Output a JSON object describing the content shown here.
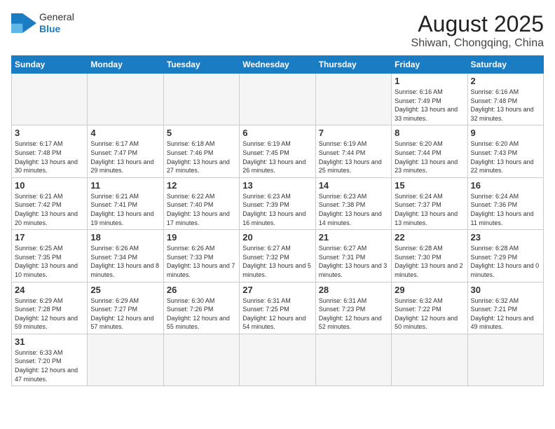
{
  "logo": {
    "general": "General",
    "blue": "Blue"
  },
  "title": "August 2025",
  "subtitle": "Shiwan, Chongqing, China",
  "weekdays": [
    "Sunday",
    "Monday",
    "Tuesday",
    "Wednesday",
    "Thursday",
    "Friday",
    "Saturday"
  ],
  "weeks": [
    [
      {
        "day": "",
        "empty": true
      },
      {
        "day": "",
        "empty": true
      },
      {
        "day": "",
        "empty": true
      },
      {
        "day": "",
        "empty": true
      },
      {
        "day": "",
        "empty": true
      },
      {
        "day": "1",
        "sunrise": "6:16 AM",
        "sunset": "7:49 PM",
        "daylight": "13 hours and 33 minutes."
      },
      {
        "day": "2",
        "sunrise": "6:16 AM",
        "sunset": "7:48 PM",
        "daylight": "13 hours and 32 minutes."
      }
    ],
    [
      {
        "day": "3",
        "sunrise": "6:17 AM",
        "sunset": "7:48 PM",
        "daylight": "13 hours and 30 minutes."
      },
      {
        "day": "4",
        "sunrise": "6:17 AM",
        "sunset": "7:47 PM",
        "daylight": "13 hours and 29 minutes."
      },
      {
        "day": "5",
        "sunrise": "6:18 AM",
        "sunset": "7:46 PM",
        "daylight": "13 hours and 27 minutes."
      },
      {
        "day": "6",
        "sunrise": "6:19 AM",
        "sunset": "7:45 PM",
        "daylight": "13 hours and 26 minutes."
      },
      {
        "day": "7",
        "sunrise": "6:19 AM",
        "sunset": "7:44 PM",
        "daylight": "13 hours and 25 minutes."
      },
      {
        "day": "8",
        "sunrise": "6:20 AM",
        "sunset": "7:44 PM",
        "daylight": "13 hours and 23 minutes."
      },
      {
        "day": "9",
        "sunrise": "6:20 AM",
        "sunset": "7:43 PM",
        "daylight": "13 hours and 22 minutes."
      }
    ],
    [
      {
        "day": "10",
        "sunrise": "6:21 AM",
        "sunset": "7:42 PM",
        "daylight": "13 hours and 20 minutes."
      },
      {
        "day": "11",
        "sunrise": "6:21 AM",
        "sunset": "7:41 PM",
        "daylight": "13 hours and 19 minutes."
      },
      {
        "day": "12",
        "sunrise": "6:22 AM",
        "sunset": "7:40 PM",
        "daylight": "13 hours and 17 minutes."
      },
      {
        "day": "13",
        "sunrise": "6:23 AM",
        "sunset": "7:39 PM",
        "daylight": "13 hours and 16 minutes."
      },
      {
        "day": "14",
        "sunrise": "6:23 AM",
        "sunset": "7:38 PM",
        "daylight": "13 hours and 14 minutes."
      },
      {
        "day": "15",
        "sunrise": "6:24 AM",
        "sunset": "7:37 PM",
        "daylight": "13 hours and 13 minutes."
      },
      {
        "day": "16",
        "sunrise": "6:24 AM",
        "sunset": "7:36 PM",
        "daylight": "13 hours and 11 minutes."
      }
    ],
    [
      {
        "day": "17",
        "sunrise": "6:25 AM",
        "sunset": "7:35 PM",
        "daylight": "13 hours and 10 minutes."
      },
      {
        "day": "18",
        "sunrise": "6:26 AM",
        "sunset": "7:34 PM",
        "daylight": "13 hours and 8 minutes."
      },
      {
        "day": "19",
        "sunrise": "6:26 AM",
        "sunset": "7:33 PM",
        "daylight": "13 hours and 7 minutes."
      },
      {
        "day": "20",
        "sunrise": "6:27 AM",
        "sunset": "7:32 PM",
        "daylight": "13 hours and 5 minutes."
      },
      {
        "day": "21",
        "sunrise": "6:27 AM",
        "sunset": "7:31 PM",
        "daylight": "13 hours and 3 minutes."
      },
      {
        "day": "22",
        "sunrise": "6:28 AM",
        "sunset": "7:30 PM",
        "daylight": "13 hours and 2 minutes."
      },
      {
        "day": "23",
        "sunrise": "6:28 AM",
        "sunset": "7:29 PM",
        "daylight": "13 hours and 0 minutes."
      }
    ],
    [
      {
        "day": "24",
        "sunrise": "6:29 AM",
        "sunset": "7:28 PM",
        "daylight": "12 hours and 59 minutes."
      },
      {
        "day": "25",
        "sunrise": "6:29 AM",
        "sunset": "7:27 PM",
        "daylight": "12 hours and 57 minutes."
      },
      {
        "day": "26",
        "sunrise": "6:30 AM",
        "sunset": "7:26 PM",
        "daylight": "12 hours and 55 minutes."
      },
      {
        "day": "27",
        "sunrise": "6:31 AM",
        "sunset": "7:25 PM",
        "daylight": "12 hours and 54 minutes."
      },
      {
        "day": "28",
        "sunrise": "6:31 AM",
        "sunset": "7:23 PM",
        "daylight": "12 hours and 52 minutes."
      },
      {
        "day": "29",
        "sunrise": "6:32 AM",
        "sunset": "7:22 PM",
        "daylight": "12 hours and 50 minutes."
      },
      {
        "day": "30",
        "sunrise": "6:32 AM",
        "sunset": "7:21 PM",
        "daylight": "12 hours and 49 minutes."
      }
    ],
    [
      {
        "day": "31",
        "sunrise": "6:33 AM",
        "sunset": "7:20 PM",
        "daylight": "12 hours and 47 minutes."
      },
      {
        "day": "",
        "empty": true
      },
      {
        "day": "",
        "empty": true
      },
      {
        "day": "",
        "empty": true
      },
      {
        "day": "",
        "empty": true
      },
      {
        "day": "",
        "empty": true
      },
      {
        "day": "",
        "empty": true
      }
    ]
  ]
}
